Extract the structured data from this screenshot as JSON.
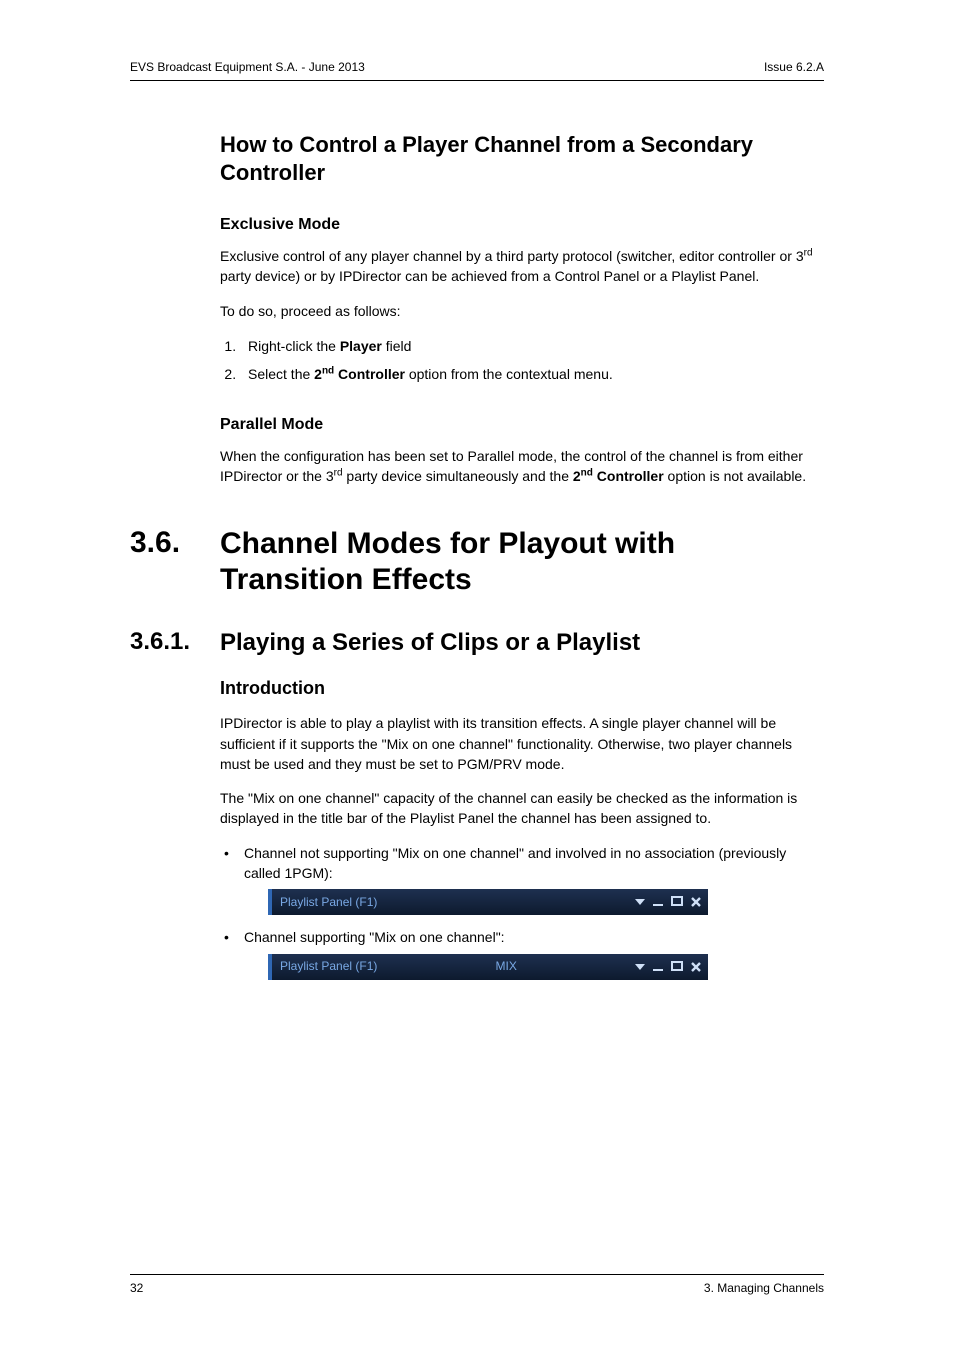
{
  "header": {
    "left": "EVS Broadcast Equipment S.A. - June 2013",
    "right": "Issue 6.2.A"
  },
  "sec1": {
    "title": "How to Control a Player Channel from a Secondary Controller",
    "exclusive": {
      "heading": "Exclusive Mode",
      "p1a": "Exclusive control of any player channel by a third party protocol (switcher, editor controller or 3",
      "p1sup": "rd",
      "p1b": " party device) or by IPDirector can be achieved from a Control Panel or a Playlist Panel.",
      "p2": "To do so, proceed as follows:",
      "step1a": "Right-click the ",
      "step1b": "Player",
      "step1c": " field",
      "step2a": "Select the ",
      "step2b": "2",
      "step2sup": "nd",
      "step2c": " Controller",
      "step2d": " option from the contextual menu."
    },
    "parallel": {
      "heading": "Parallel Mode",
      "p1a": "When the configuration has been set to Parallel mode, the control of the channel is from either IPDirector or the 3",
      "p1sup1": "rd",
      "p1b": " party device simultaneously and the ",
      "p1bold_a": "2",
      "p1sup2": "nd",
      "p1bold_b": " Controller",
      "p1c": " option is not available."
    }
  },
  "chapter": {
    "num": "3.6.",
    "title": "Channel Modes for Playout with Transition Effects"
  },
  "sub": {
    "num": "3.6.1.",
    "title": "Playing a Series of Clips or a Playlist"
  },
  "intro": {
    "heading": "Introduction",
    "p1": "IPDirector is able to play a playlist with its transition effects. A single player channel will be sufficient if it supports the \"Mix on one channel\" functionality. Otherwise, two player channels must be used and they must be set to PGM/PRV mode.",
    "p2": "The \"Mix on one channel\" capacity of the channel can easily be checked as the information is displayed in the title bar of the Playlist Panel the channel has been assigned to.",
    "b1": "Channel not supporting \"Mix on one channel\" and involved in no association (previously called 1PGM):",
    "b2": "Channel supporting \"Mix on one channel\":"
  },
  "titlebar": {
    "title": "Playlist Panel (F1)",
    "mix": "MIX"
  },
  "footer": {
    "left": "32",
    "right": "3. Managing Channels"
  }
}
